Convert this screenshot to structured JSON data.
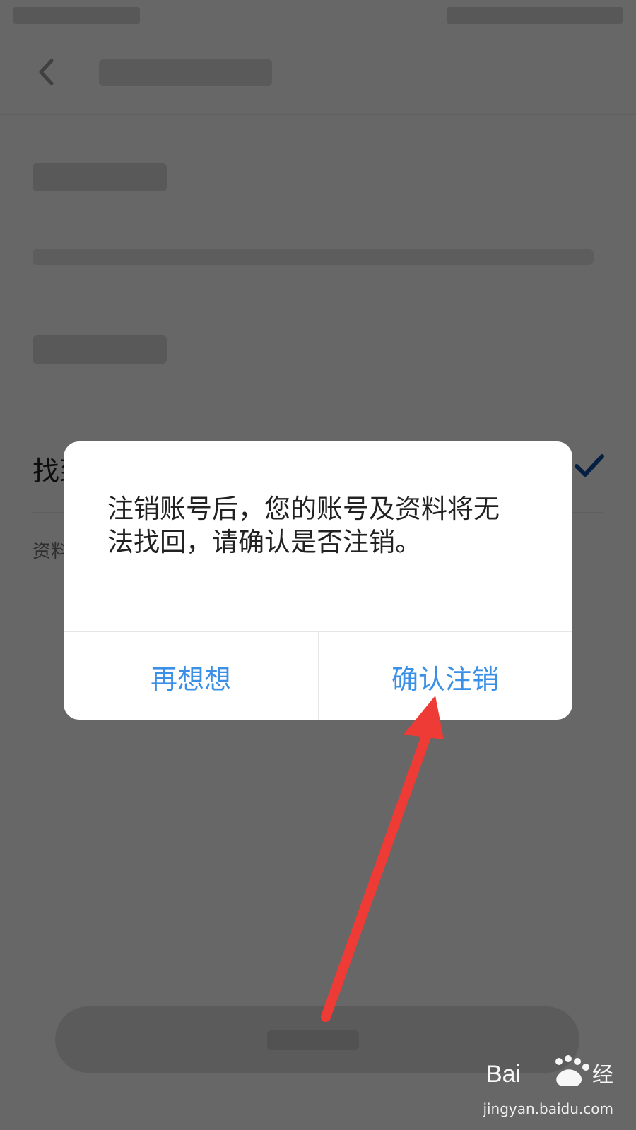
{
  "page": {
    "selected_row_label": "找到",
    "resource_text": "资料"
  },
  "dialog": {
    "message": "注销账号后，您的账号及资料将无\n法找回，请确认是否注销。",
    "cancel_label": "再想想",
    "confirm_label": "确认注销"
  },
  "watermark": {
    "site": "jingyan.baidu.com"
  },
  "colors": {
    "accent": "#3a8fe6",
    "check": "#0b4a9d",
    "arrow": "#ef3b35"
  },
  "icons": {
    "back": "back-icon",
    "check": "check-icon",
    "paw": "paw-icon"
  }
}
